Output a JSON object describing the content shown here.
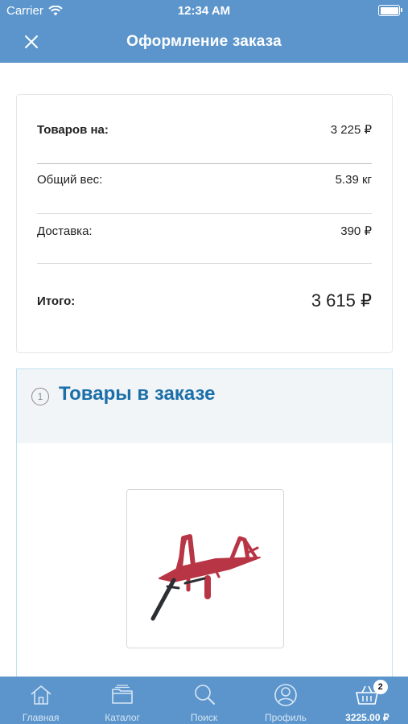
{
  "status_bar": {
    "carrier": "Carrier",
    "time": "12:34 AM"
  },
  "nav": {
    "title": "Оформление заказа"
  },
  "summary": {
    "goods_label": "Товаров на:",
    "goods_value": "3 225 ₽",
    "weight_label": "Общий вес:",
    "weight_value": "5.39 кг",
    "delivery_label": "Доставка:",
    "delivery_value": "390 ₽",
    "total_label": "Итого:",
    "total_value": "3 615 ₽"
  },
  "items": {
    "step": "1",
    "heading": "Товары в заказе"
  },
  "tabs": [
    {
      "label": "Главная",
      "icon": "home-icon"
    },
    {
      "label": "Каталог",
      "icon": "folder-icon"
    },
    {
      "label": "Поиск",
      "icon": "search-icon"
    },
    {
      "label": "Профиль",
      "icon": "profile-icon"
    },
    {
      "label": "3225.00 ₽",
      "icon": "basket-icon",
      "badge": "2"
    }
  ],
  "colors": {
    "header": "#5b95cc",
    "heading": "#1c6fa8",
    "product": "#b83545"
  }
}
